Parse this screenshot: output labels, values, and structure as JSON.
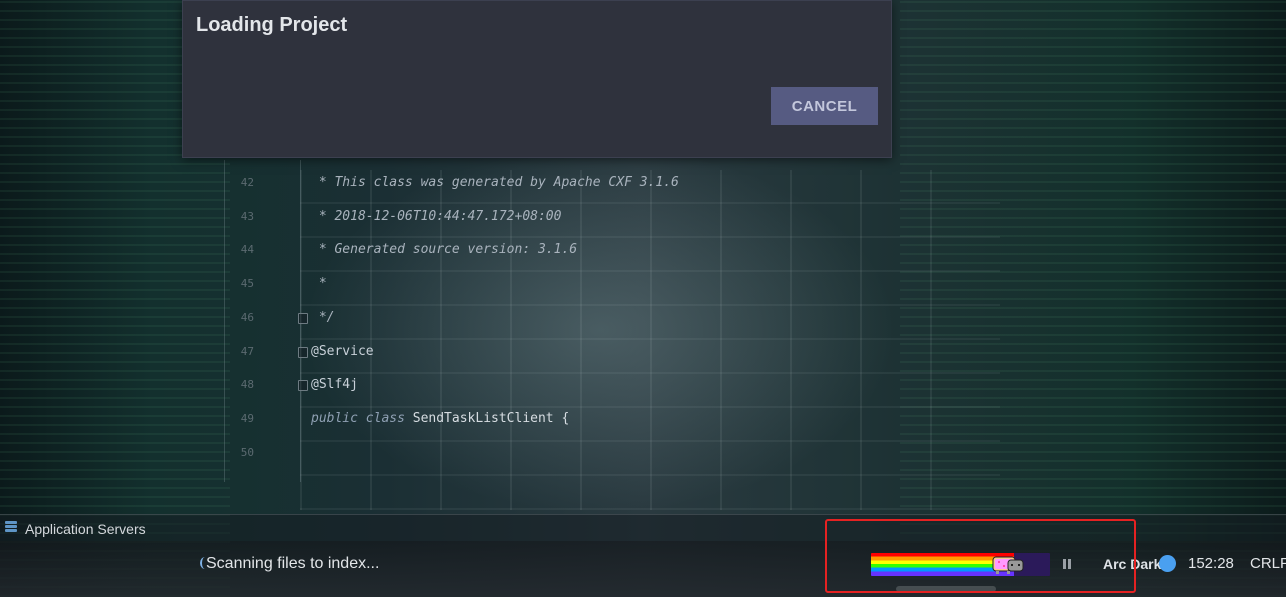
{
  "dialog": {
    "title": "Loading Project",
    "cancel_label": "CANCEL"
  },
  "editor": {
    "lines": [
      {
        "num": "42",
        "text": " * This class was generated by Apache CXF 3.1.6"
      },
      {
        "num": "43",
        "text": " * 2018-12-06T10:44:47.172+08:00"
      },
      {
        "num": "44",
        "text": " * Generated source version: 3.1.6"
      },
      {
        "num": "45",
        "text": " *"
      },
      {
        "num": "46",
        "text": " */"
      },
      {
        "num": "47",
        "text": "@Service"
      },
      {
        "num": "48",
        "text": "@Slf4j"
      },
      {
        "num": "49",
        "keyword": "public class ",
        "text": "SendTaskListClient {"
      },
      {
        "num": "50",
        "text": ""
      }
    ]
  },
  "tool_window": {
    "label": "Application Servers",
    "icon": "server-stack-icon"
  },
  "statusbar": {
    "task_text": "Scanning files to index...",
    "progress_fraction": 0.8,
    "progress_icon": "nyan-cat-icon",
    "theme_label": "Arc Dark",
    "cursor_position": "152:28",
    "line_separator": "CRLF"
  },
  "colors": {
    "dialog_bg": "#2f323d",
    "cancel_button_bg": "#565b82",
    "highlight_border": "#e52222",
    "theme_dot": "#4aa0f0"
  }
}
